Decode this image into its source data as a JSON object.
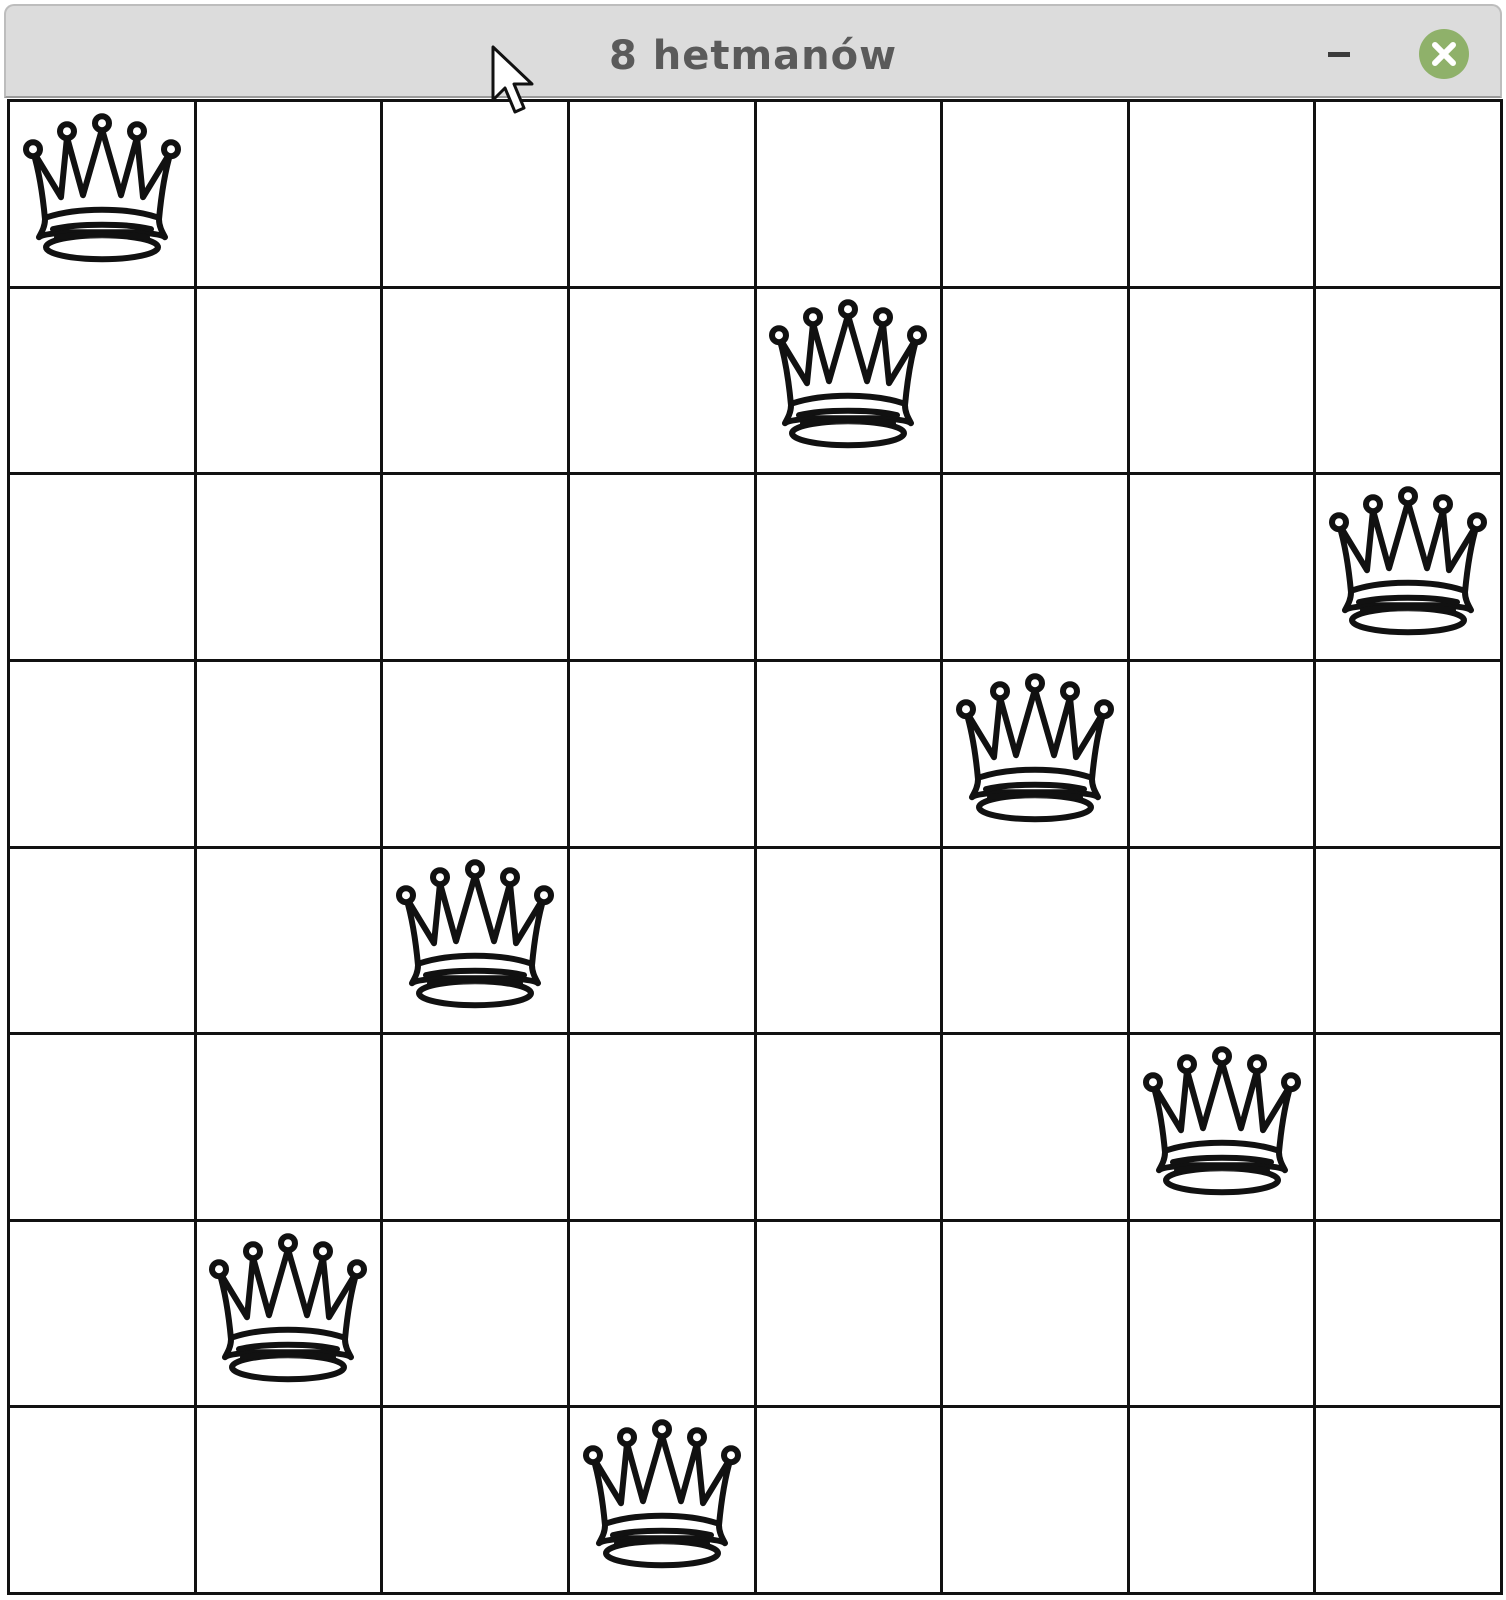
{
  "window": {
    "title": "8 hetmanów",
    "minimize_icon": "minimize-icon",
    "close_icon": "close-icon",
    "close_color": "#8fb16a"
  },
  "board": {
    "rows": 8,
    "cols": 8,
    "piece": "white-queen-icon",
    "queen_columns_by_row": [
      0,
      4,
      7,
      5,
      2,
      6,
      1,
      3
    ]
  }
}
